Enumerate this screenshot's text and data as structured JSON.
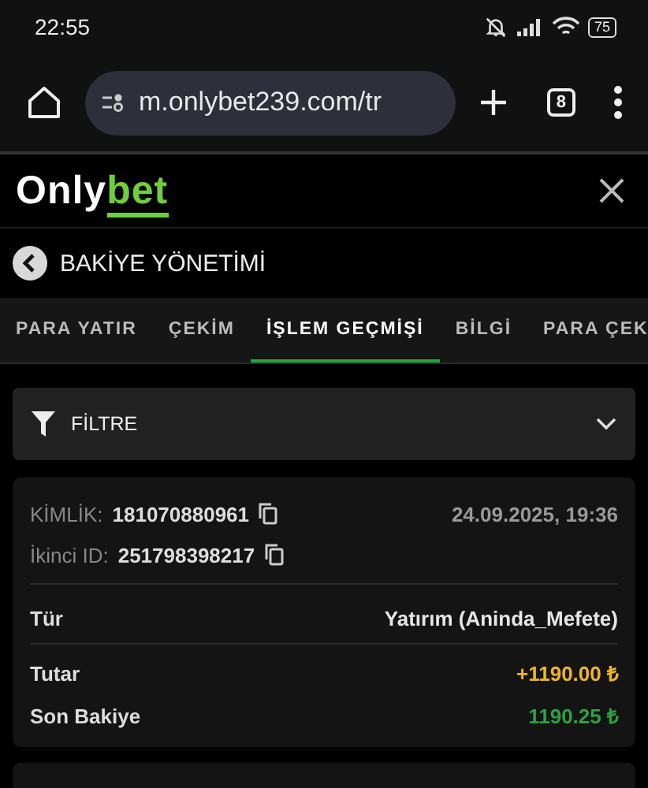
{
  "status_bar": {
    "time": "22:55",
    "battery": "75"
  },
  "browser": {
    "url": "m.onlybet239.com/tr",
    "tab_count": "8"
  },
  "logo": {
    "primary": "Only",
    "accent": "bet"
  },
  "page_title": "BAKİYE YÖNETİMİ",
  "tabs": [
    {
      "label": "PARA YATIR",
      "selected": false
    },
    {
      "label": "ÇEKİM",
      "selected": false
    },
    {
      "label": "İŞLEM GEÇMİŞİ",
      "selected": true
    },
    {
      "label": "BİLGİ",
      "selected": false
    },
    {
      "label": "PARA ÇEK",
      "selected": false
    }
  ],
  "filter": {
    "label": "FİLTRE",
    "expanded": false
  },
  "transaction": {
    "id_label": "KİMLİK:",
    "id": "181070880961",
    "second_id_label": "İkinci ID:",
    "second_id": "251798398217",
    "date": "24.09.2025, 19:36",
    "rows": [
      {
        "label": "Tür",
        "value": "Yatırım (Aninda_Mefete)",
        "color": "#e6e6e6",
        "divider": true
      },
      {
        "label": "Tutar",
        "value": "+1190.00 ₺",
        "color": "#f0b429",
        "divider": false
      },
      {
        "label": "Son Bakiye",
        "value": "1190.25 ₺",
        "color": "#2ea043",
        "divider": false
      }
    ]
  }
}
